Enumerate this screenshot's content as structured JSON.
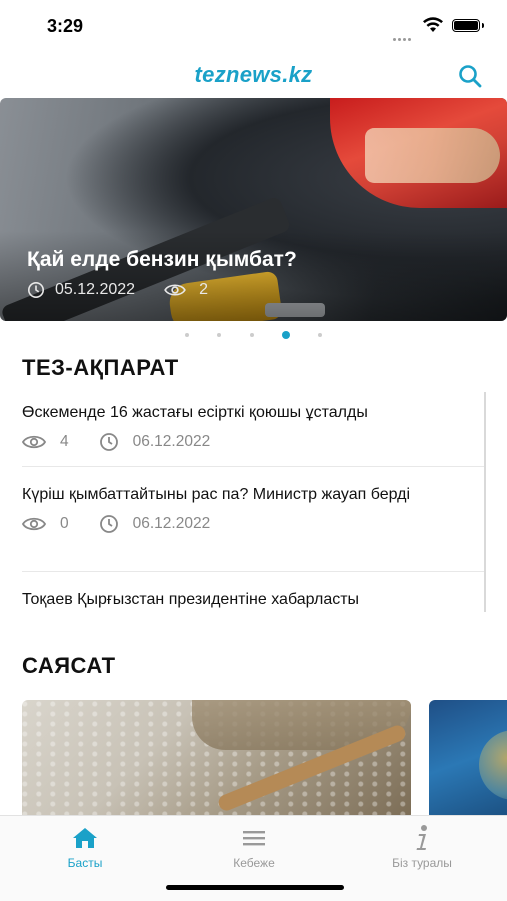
{
  "status_bar": {
    "time": "3:29"
  },
  "header": {
    "logo": "teznews.kz"
  },
  "hero": {
    "title": "Қай елде бензин қымбат?",
    "date": "05.12.2022",
    "views": "2"
  },
  "pager": {
    "count": 5,
    "active": 4
  },
  "quick_news": {
    "title": "ТЕЗ-АҚПАРАТ",
    "items": [
      {
        "headline": "Өскеменде 16 жастағы есірткі қоюшы ұсталды",
        "views": "4",
        "date": "06.12.2022"
      },
      {
        "headline": "Күріш қымбаттайтыны рас па? Министр жауап берді",
        "views": "0",
        "date": "06.12.2022"
      },
      {
        "headline": "Тоқаев Қырғызстан президентіне хабарласты"
      }
    ]
  },
  "politics": {
    "title": "САЯСАТ"
  },
  "tabbar": {
    "tabs": [
      {
        "label": "Басты",
        "icon": "home-icon",
        "active": true
      },
      {
        "label": "Кебеже",
        "icon": "menu-icon",
        "active": false
      },
      {
        "label": "Біз туралы",
        "icon": "info-icon",
        "active": false
      }
    ]
  },
  "colors": {
    "accent": "#1aa1c8"
  }
}
